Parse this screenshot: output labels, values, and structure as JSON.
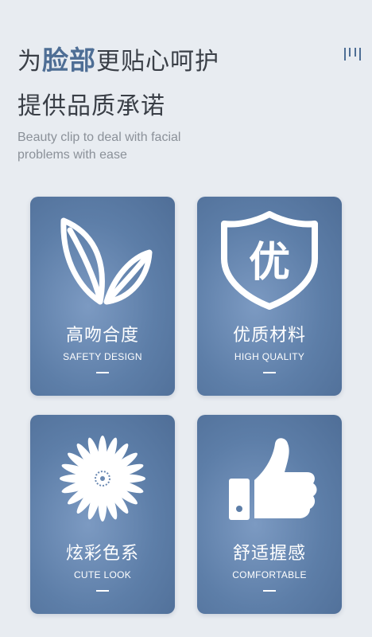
{
  "headline": {
    "line1_pre": "为",
    "line1_em": "脸部",
    "line1_post": "更贴心呵护",
    "line2": "提供品质承诺"
  },
  "subtitle": "Beauty clip to deal with facial problems with ease",
  "accent_color": "#4e6e95",
  "cards": [
    {
      "icon": "leaf-icon",
      "title_cn": "高吻合度",
      "title_en": "SAFETY DESIGN"
    },
    {
      "icon": "shield-icon",
      "badge": "优",
      "title_cn": "优质材料",
      "title_en": "HIGH QUALITY"
    },
    {
      "icon": "flower-icon",
      "title_cn": "炫彩色系",
      "title_en": "CUTE LOOK"
    },
    {
      "icon": "thumbs-up-icon",
      "title_cn": "舒适握感",
      "title_en": "COMFORTABLE"
    }
  ]
}
